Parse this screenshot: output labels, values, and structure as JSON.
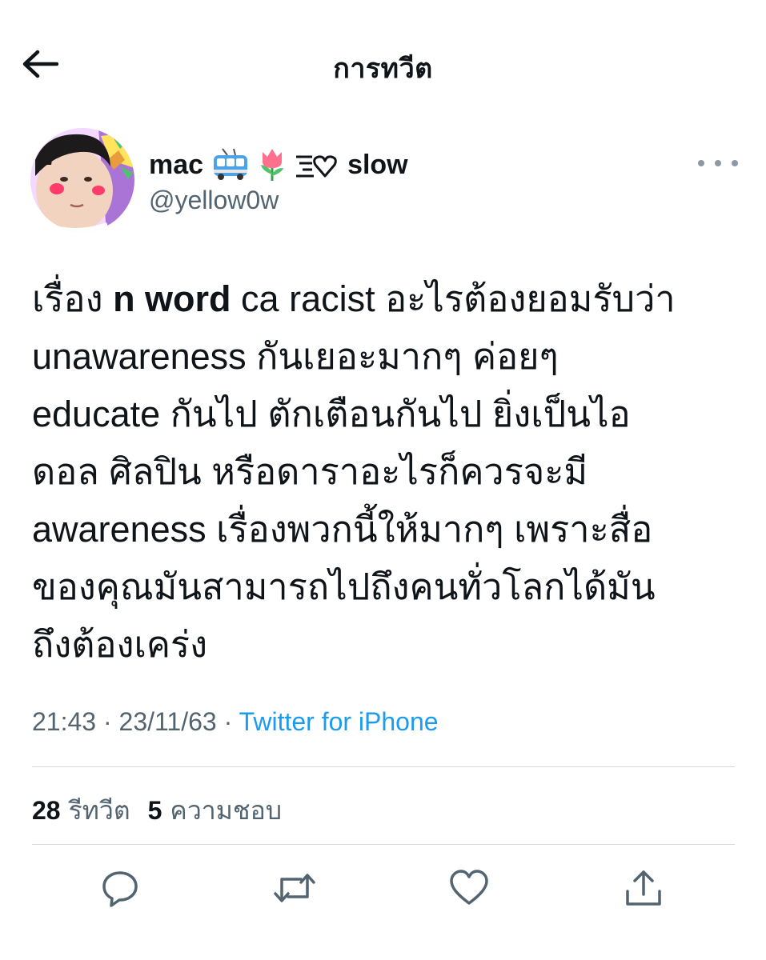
{
  "header": {
    "title": "การทวีต",
    "back_icon": "arrow-left-icon"
  },
  "author": {
    "name_prefix": "mac",
    "emojis": [
      "trolleybus-emoji",
      "tulip-emoji",
      "speed-heart-emoji"
    ],
    "name_suffix": "slow",
    "handle": "@yellow0w"
  },
  "tweet": {
    "text_lines": [
      [
        "เรื่อง ",
        "n word",
        " ca racist อะไรต้องยอมรับว่า"
      ],
      "unawareness กันเยอะมากๆ ค่อยๆ",
      "educate กันไป ตักเตือนกันไป ยิ่งเป็นไอ",
      "ดอล ศิลปิน หรือดาราอะไรก็ควรจะมี",
      "awareness เรื่องพวกนี้ให้มากๆ เพราะสื่อ",
      "ของคุณมันสามารถไปถึงคนทั่วโลกได้มัน",
      "ถึงต้องเคร่ง"
    ],
    "time": "21:43",
    "date": "23/11/63",
    "separator": "·",
    "source": "Twitter for iPhone"
  },
  "stats": {
    "retweets_count": "28",
    "retweets_label": "รีทวีต",
    "likes_count": "5",
    "likes_label": "ความชอบ"
  },
  "actions": [
    "reply-icon",
    "retweet-icon",
    "like-icon",
    "share-icon"
  ],
  "colors": {
    "text": "#0f1419",
    "secondary": "#536471",
    "link": "#1d9bf0",
    "divider": "#d6dadd"
  }
}
